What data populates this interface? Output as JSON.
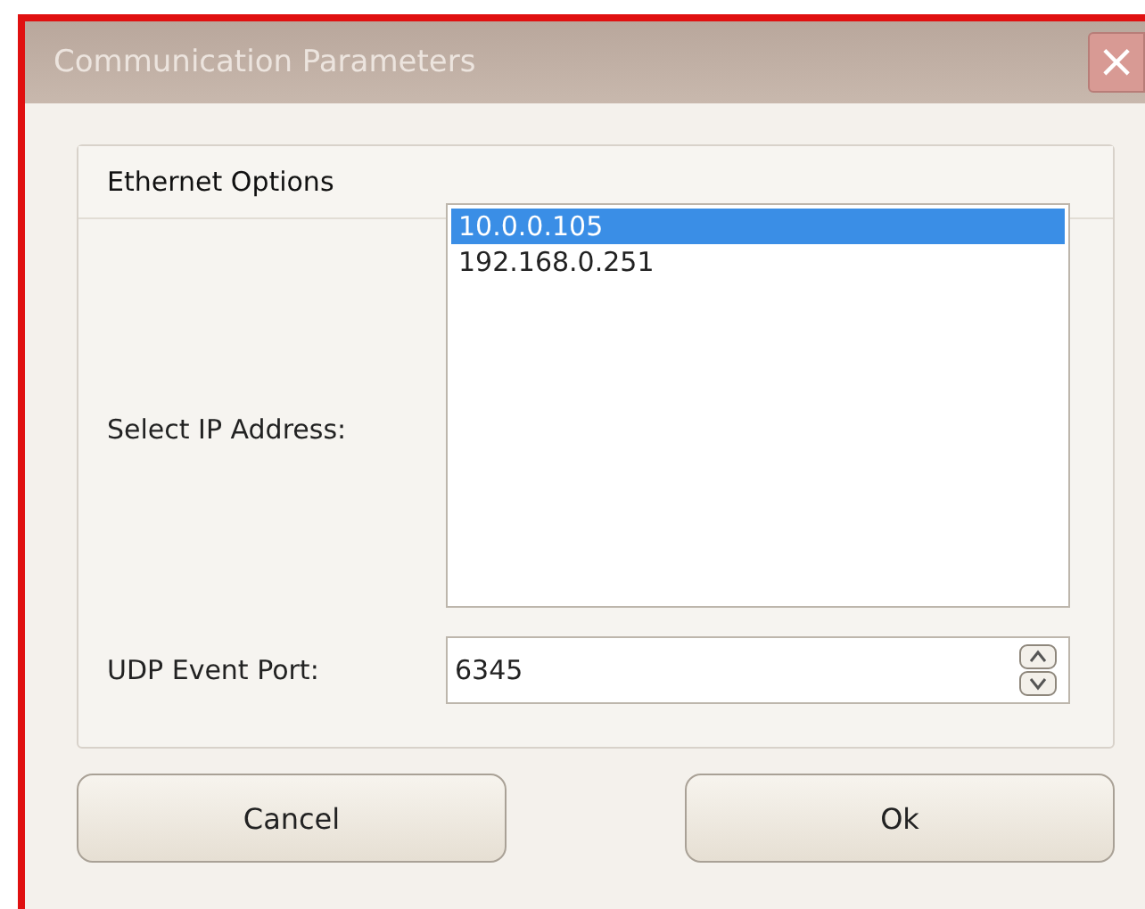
{
  "window": {
    "title": "Communication Parameters",
    "close_button": "×"
  },
  "group": {
    "title": "Ethernet Options",
    "ip_label": "Select IP Address:",
    "ip_addresses": [
      {
        "address": "10.0.0.105",
        "selected": true
      },
      {
        "address": "192.168.0.251",
        "selected": false
      }
    ],
    "port_label": "UDP Event Port:",
    "port_value": "6345"
  },
  "buttons": [
    "Cancel",
    "Ok"
  ]
}
